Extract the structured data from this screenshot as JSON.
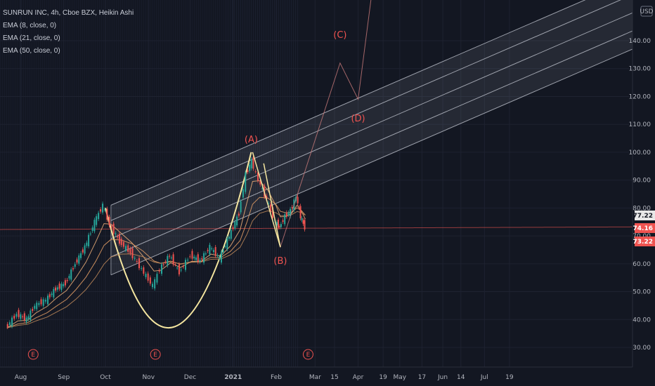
{
  "legend": {
    "title": "SUNRUN INC, 4h, Cboe BZX, Heikin Ashi",
    "ema1": "EMA (8, close, 0)",
    "ema2": "EMA (21, close, 0)",
    "ema3": "EMA (50, close, 0)"
  },
  "currency_label": "USD",
  "price_badges": [
    {
      "value": "77.22",
      "color": "#e8e8e8",
      "text_color": "#131722"
    },
    {
      "value": "74.16",
      "color": "#ef5350",
      "text_color": "#ffffff"
    },
    {
      "value": "73.22",
      "color": "#ef5350",
      "text_color": "#ffffff"
    }
  ],
  "colors": {
    "background": "#131722",
    "up": "#26a69a",
    "down": "#ef5350",
    "cup": "#f5e6a0",
    "channel": "#c8ccd6",
    "wave": "#ef5350"
  },
  "chart_data": {
    "type": "candlestick",
    "y_ticks": [
      30,
      40,
      50,
      60,
      70,
      80,
      90,
      100,
      110,
      120,
      130,
      140
    ],
    "y_tick_labels": [
      "30.00",
      "40.00",
      "50.00",
      "60.00",
      "70.00",
      "80.00",
      "90.00",
      "100.00",
      "110.00",
      "120.00",
      "130.00",
      "140.00"
    ],
    "ylim": [
      25,
      152
    ],
    "x_ticks": [
      "Aug",
      "Sep",
      "Oct",
      "Nov",
      "Dec",
      "2021",
      "Feb",
      "Mar",
      "15",
      "Apr",
      "19",
      "May",
      "17",
      "Jun",
      "14",
      "Jul",
      "19"
    ],
    "wave_labels": [
      "(A)",
      "(B)",
      "(C)",
      "(D)"
    ],
    "event_markers": [
      "E",
      "E",
      "E"
    ],
    "price_path": [
      [
        "2020-07-22",
        37
      ],
      [
        "2020-07-30",
        42
      ],
      [
        "2020-08-06",
        40
      ],
      [
        "2020-08-12",
        45
      ],
      [
        "2020-08-20",
        47
      ],
      [
        "2020-08-27",
        51
      ],
      [
        "2020-09-03",
        53
      ],
      [
        "2020-09-10",
        60
      ],
      [
        "2020-09-17",
        66
      ],
      [
        "2020-09-24",
        75
      ],
      [
        "2020-09-30",
        81
      ],
      [
        "2020-10-05",
        74
      ],
      [
        "2020-10-12",
        68
      ],
      [
        "2020-10-20",
        64
      ],
      [
        "2020-10-28",
        58
      ],
      [
        "2020-11-05",
        52
      ],
      [
        "2020-11-10",
        58
      ],
      [
        "2020-11-17",
        63
      ],
      [
        "2020-11-24",
        57
      ],
      [
        "2020-12-02",
        63
      ],
      [
        "2020-12-09",
        61
      ],
      [
        "2020-12-16",
        66
      ],
      [
        "2020-12-23",
        62
      ],
      [
        "2020-12-30",
        70
      ],
      [
        "2021-01-06",
        78
      ],
      [
        "2021-01-11",
        92
      ],
      [
        "2021-01-15",
        97
      ],
      [
        "2021-01-20",
        90
      ],
      [
        "2021-01-26",
        83
      ],
      [
        "2021-02-01",
        75
      ],
      [
        "2021-02-04",
        73
      ],
      [
        "2021-02-08",
        77
      ],
      [
        "2021-02-12",
        79
      ],
      [
        "2021-02-16",
        84
      ],
      [
        "2021-02-19",
        77
      ],
      [
        "2021-02-22",
        73
      ]
    ]
  }
}
